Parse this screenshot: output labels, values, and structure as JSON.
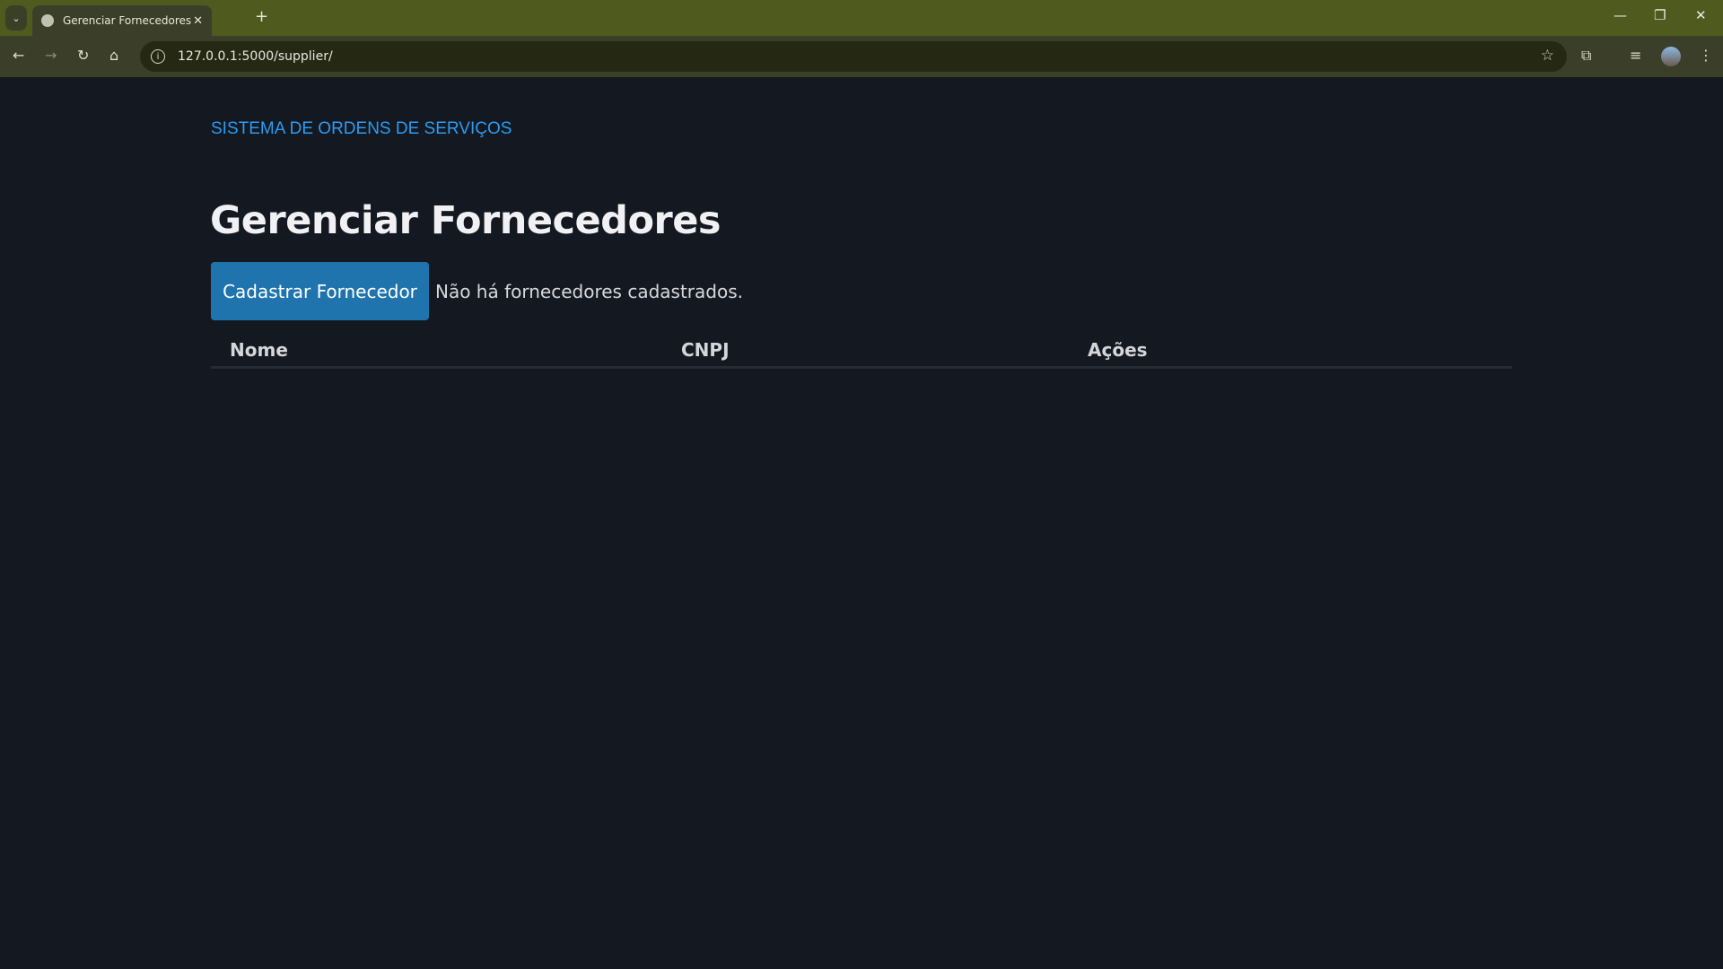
{
  "browser": {
    "tab_title": "Gerenciar Fornecedores",
    "new_tab": "+",
    "url": "127.0.0.1:5000/supplier/"
  },
  "app": {
    "brand": "SISTEMA DE ORDENS DE SERVIÇOS",
    "title": "Gerenciar Fornecedores",
    "add_button": "Cadastrar Fornecedor",
    "empty_message": "Não há fornecedores cadastrados.",
    "columns": [
      "Nome",
      "CNPJ",
      "Ações"
    ]
  },
  "colors": {
    "accent": "#1f74ad",
    "brand": "#2b9cf2",
    "background": "#141821"
  }
}
